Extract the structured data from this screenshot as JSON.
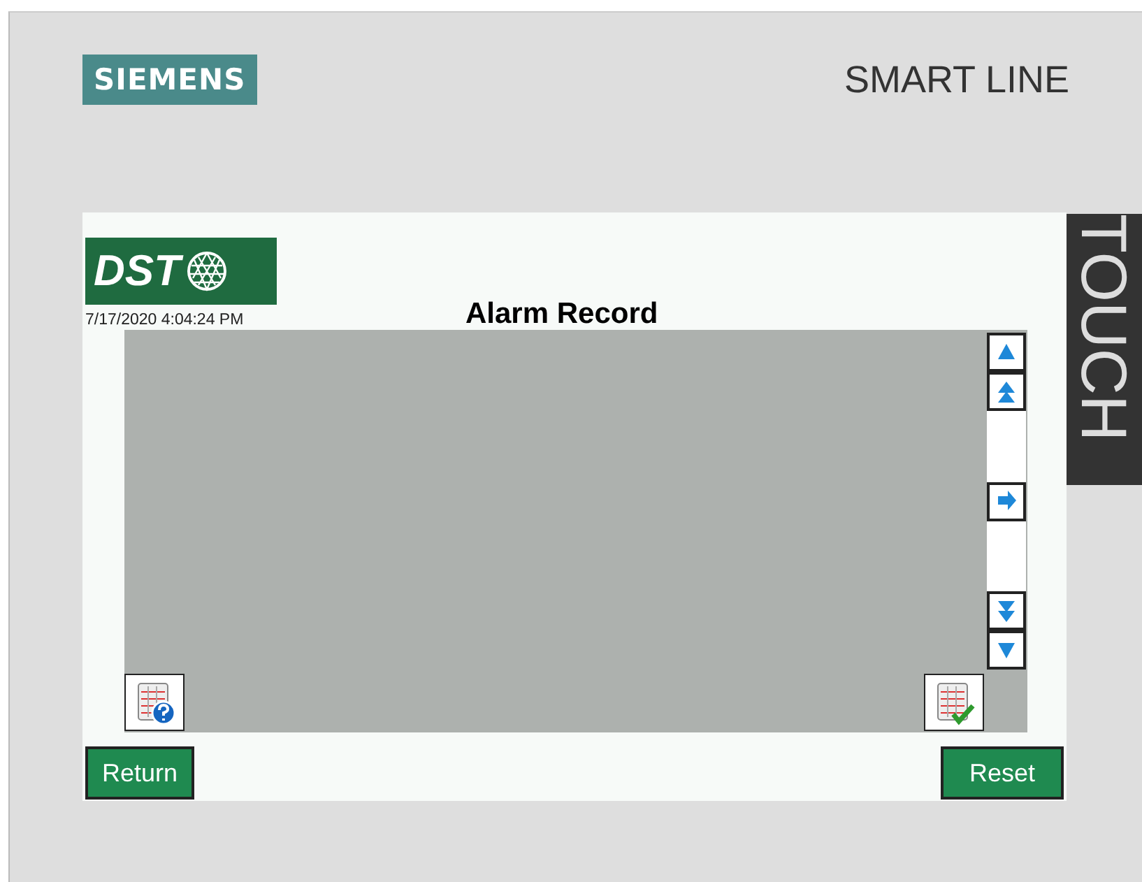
{
  "header": {
    "brand_logo": "SIEMENS",
    "product_line": "SMART LINE"
  },
  "side_badge": "TOUCH",
  "screen": {
    "logo": "DST",
    "datetime": "7/17/2020 4:04:24 PM",
    "title": "Alarm Record",
    "alarm_view": {
      "scroll_buttons": [
        {
          "kind": "line_up"
        },
        {
          "kind": "page_up"
        },
        {
          "kind": "gap"
        },
        {
          "kind": "right"
        },
        {
          "kind": "gap"
        },
        {
          "kind": "page_down"
        },
        {
          "kind": "line_down"
        }
      ],
      "tool_buttons": [
        {
          "kind": "help"
        },
        {
          "kind": "acknowledge"
        }
      ]
    },
    "buttons": [
      {
        "label": "Return"
      },
      {
        "label": "Reset"
      }
    ]
  }
}
